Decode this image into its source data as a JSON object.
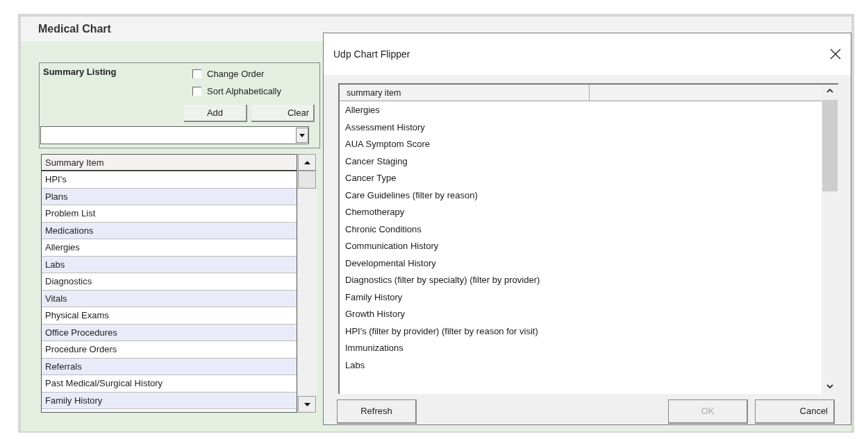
{
  "window": {
    "title": "Medical Chart"
  },
  "summary_listing": {
    "title": "Summary Listing",
    "options": [
      {
        "label": "Change Order",
        "checked": false
      },
      {
        "label": "Sort Alphabetically",
        "checked": false
      }
    ],
    "buttons": [
      {
        "label": "Add"
      },
      {
        "label": "Clear"
      }
    ],
    "table": {
      "columns": [
        "Summary Item"
      ],
      "rows": [
        "HPI's",
        "Plans",
        "Problem List",
        "Medications",
        "Allergies",
        "Labs",
        "Diagnostics",
        "Vitals",
        "Physical Exams",
        "Office Procedures",
        "Procedure Orders",
        "Referrals",
        "Past Medical/Surgical History",
        "Family History"
      ]
    }
  },
  "dialog": {
    "title": "Udp Chart Flipper",
    "list": {
      "columns": [
        "summary item"
      ],
      "rows": [
        "Allergies",
        "Assessment History",
        "AUA Symptom Score",
        "Cancer Staging",
        "Cancer Type",
        "Care Guidelines (filter by reason)",
        "Chemotherapy",
        "Chronic Conditions",
        "Communication History",
        "Developmental History",
        "Diagnostics (filter by specialty) (filter by provider)",
        "Family History",
        "Growth History",
        "HPI's (filter by provider) (filter by reason for visit)",
        "Immunizations",
        "Labs"
      ]
    },
    "buttons": [
      {
        "label": "Refresh",
        "disabled": false
      },
      {
        "label": "OK",
        "disabled": true
      },
      {
        "label": "Cancel",
        "disabled": false
      }
    ]
  }
}
